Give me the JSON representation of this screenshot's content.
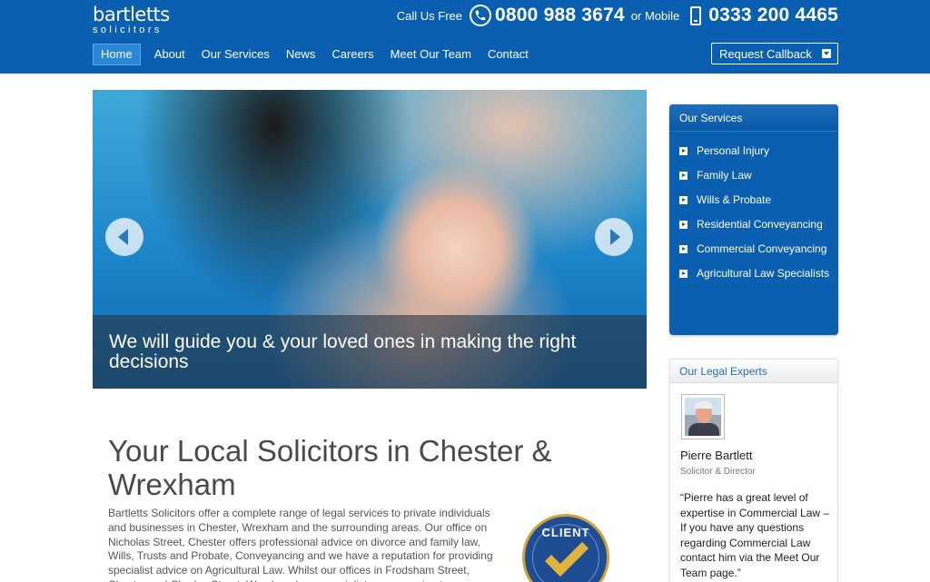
{
  "header": {
    "logo_line1": "bartletts",
    "logo_line2": "solicitors",
    "call_free_label": "Call Us Free",
    "freephone": "0800 988 3674",
    "mobile_label": "or Mobile",
    "mobile": "0333 200 4465",
    "callback_label": "Request Callback",
    "icons": [
      "phone-icon",
      "mobile-phone-icon",
      "dropdown-icon"
    ]
  },
  "nav": {
    "items": [
      "Home",
      "About",
      "Our Services",
      "News",
      "Careers",
      "Meet Our Team",
      "Contact"
    ],
    "active": "Home"
  },
  "slider": {
    "caption": "We will guide you & your loved ones in making the right decisions",
    "icons": [
      "arrow-left-icon",
      "arrow-right-icon"
    ]
  },
  "main": {
    "heading": "Your Local Solicitors in Chester & Wrexham",
    "intro": "Bartletts Solicitors offer a complete range of legal services to private individuals and businesses in Chester, Wrexham and the surrounding areas. Our office on Nicholas Street, Chester offers professional advice on divorce and family law, Wills, Trusts and Probate, Conveyancing and we have a reputation for providing specialist advice on Agricultural Law.  Whilst our offices in Frodsham Street, Chester and Charles Street, Wrexham have specialist conveyancing teams.",
    "badge_text": "CLIENT"
  },
  "services": {
    "title": "Our Services",
    "items": [
      "Personal Injury",
      "Family Law",
      "Wills & Probate",
      "Residential Conveyancing",
      "Commercial Conveyancing",
      "Agricultural Law Specialists"
    ]
  },
  "experts": {
    "title": "Our Legal Experts",
    "name": "Pierre Bartlett",
    "role": "Solicitor & Director",
    "quote": "“Pierre has a great level of expertise in Commercial Law – If you have any questions regarding Commercial Law contact him via the Meet Our Team page.”"
  },
  "colors": {
    "header_blue": "#0b5fb0",
    "nav_active": "#2a86d6",
    "badge_gold": "#cfa33a"
  }
}
